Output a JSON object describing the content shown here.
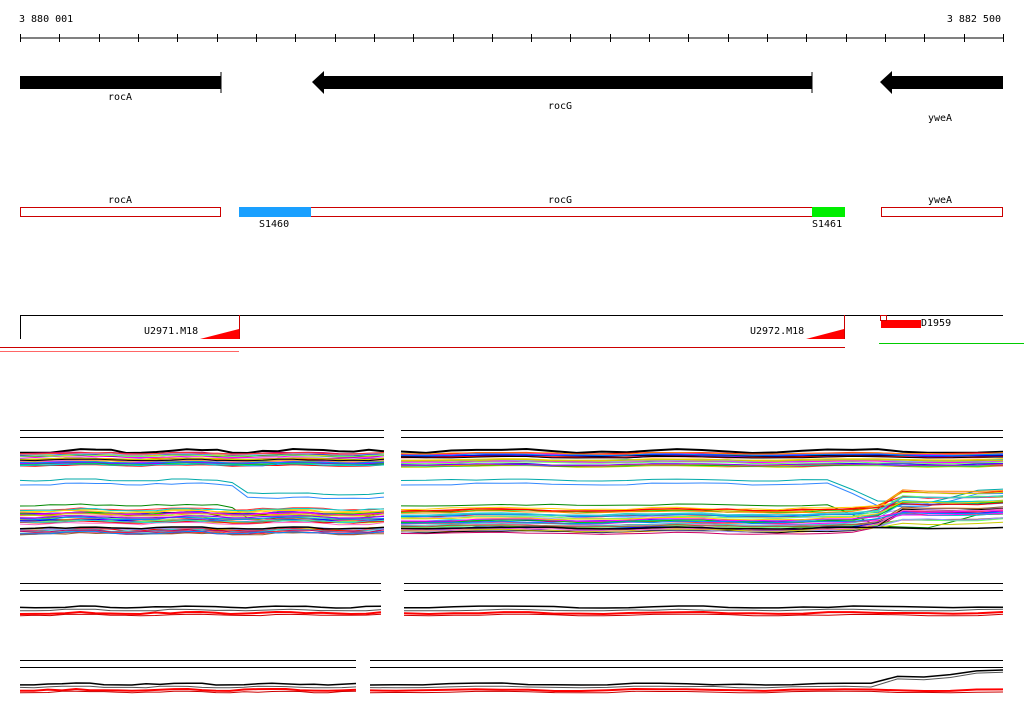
{
  "ruler": {
    "start_label": "3 880 001",
    "end_label": "3 882 500"
  },
  "genes": [
    {
      "label": "rocA",
      "strand": "+"
    },
    {
      "label": "rocG",
      "strand": "-"
    },
    {
      "label": "yweA",
      "strand": "-"
    }
  ],
  "annotation_track": {
    "boxes": [
      {
        "label": "rocA"
      },
      {
        "label": "rocG"
      },
      {
        "label": "yweA"
      }
    ],
    "segments": [
      {
        "label": "S1460",
        "color": "#1aa0ff"
      },
      {
        "label": "S1461",
        "color": "#00ee00"
      }
    ]
  },
  "features": [
    {
      "label": "U2971.M18"
    },
    {
      "label": "U2972.M18"
    },
    {
      "label": "D1959"
    }
  ],
  "colors": {
    "gene": "#000000",
    "box_outline": "#cc0000",
    "feature": "#ff0000",
    "green_line": "#00cc00"
  },
  "expression_palette": [
    "#ff0000",
    "#00cc00",
    "#0000ff",
    "#ff00ff",
    "#00cccc",
    "#ffcc00",
    "#ff8800",
    "#8800ff",
    "#cccc00",
    "#000000",
    "#0088ff",
    "#66ff66",
    "#cc0066",
    "#ff66cc",
    "#996633",
    "#33cccc",
    "#9999ff",
    "#ff3333"
  ]
}
